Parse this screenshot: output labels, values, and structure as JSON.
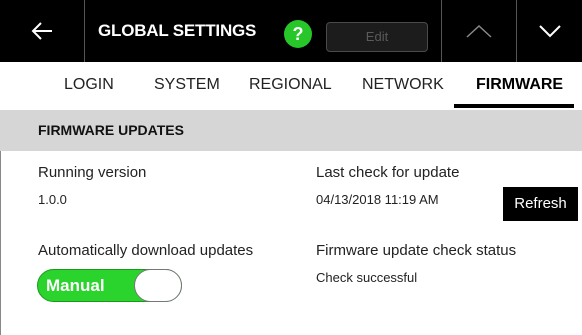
{
  "header": {
    "title": "GLOBAL SETTINGS",
    "help_label": "?",
    "edit_label": "Edit",
    "icons": [
      "back-arrow-icon",
      "chevron-up-icon",
      "chevron-down-icon"
    ]
  },
  "tabs": [
    {
      "label": "LOGIN",
      "active": false
    },
    {
      "label": "SYSTEM",
      "active": false
    },
    {
      "label": "REGIONAL",
      "active": false
    },
    {
      "label": "NETWORK",
      "active": false
    },
    {
      "label": "FIRMWARE",
      "active": true
    }
  ],
  "section": {
    "title": "FIRMWARE UPDATES"
  },
  "running_version": {
    "label": "Running version",
    "value": "1.0.0"
  },
  "last_check": {
    "label": "Last check for update",
    "value": "04/13/2018 11:19 AM",
    "refresh_label": "Refresh"
  },
  "auto_download": {
    "label": "Automatically download updates",
    "toggle_label": "Manual"
  },
  "check_status": {
    "label": "Firmware update check status",
    "value": "Check successful"
  },
  "colors": {
    "header_bg": "#000000",
    "accent_green": "#2bd42d",
    "section_bg": "#d6d6d6"
  }
}
